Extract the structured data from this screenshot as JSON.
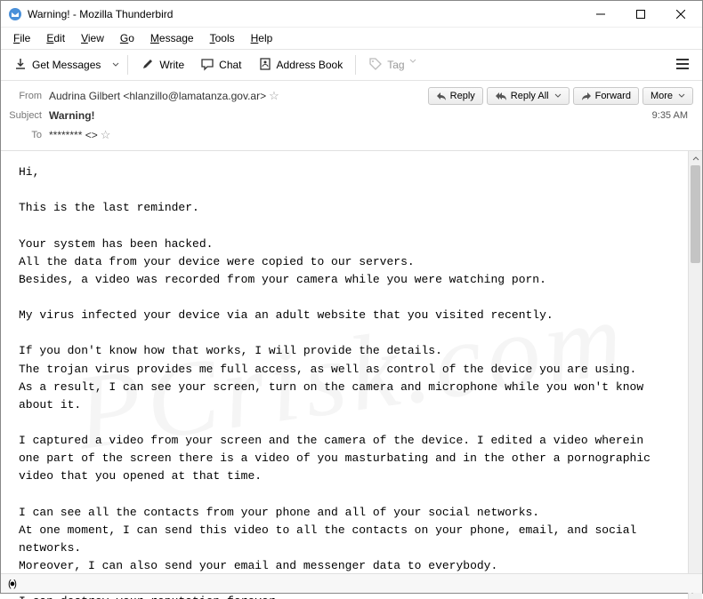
{
  "window": {
    "title": "Warning! - Mozilla Thunderbird"
  },
  "menu": {
    "file": "File",
    "edit": "Edit",
    "view": "View",
    "go": "Go",
    "message": "Message",
    "tools": "Tools",
    "help": "Help"
  },
  "toolbar": {
    "get_messages": "Get Messages",
    "write": "Write",
    "chat": "Chat",
    "address_book": "Address Book",
    "tag": "Tag"
  },
  "header": {
    "from_label": "From",
    "from_value": "Audrina Gilbert <hlanzillo@lamatanza.gov.ar>",
    "subject_label": "Subject",
    "subject_value": "Warning!",
    "to_label": "To",
    "to_value": "******** <>",
    "time": "9:35 AM"
  },
  "actions": {
    "reply": "Reply",
    "reply_all": "Reply All",
    "forward": "Forward",
    "more": "More"
  },
  "body": "Hi,\n\nThis is the last reminder.\n\nYour system has been hacked.\nAll the data from your device were copied to our servers.\nBesides, a video was recorded from your camera while you were watching porn.\n\nMy virus infected your device via an adult website that you visited recently.\n\nIf you don't know how that works, I will provide the details.\nThe trojan virus provides me full access, as well as control of the device you are using.\nAs a result, I can see your screen, turn on the camera and microphone while you won't know about it.\n\nI captured a video from your screen and the camera of the device. I edited a video wherein one part of the screen there is a video of you masturbating and in the other a pornographic video that you opened at that time.\n\nI can see all the contacts from your phone and all of your social networks.\nAt one moment, I can send this video to all the contacts on your phone, email, and social networks.\nMoreover, I can also send your email and messenger data to everybody.\n\nI can destroy your reputation forever."
}
